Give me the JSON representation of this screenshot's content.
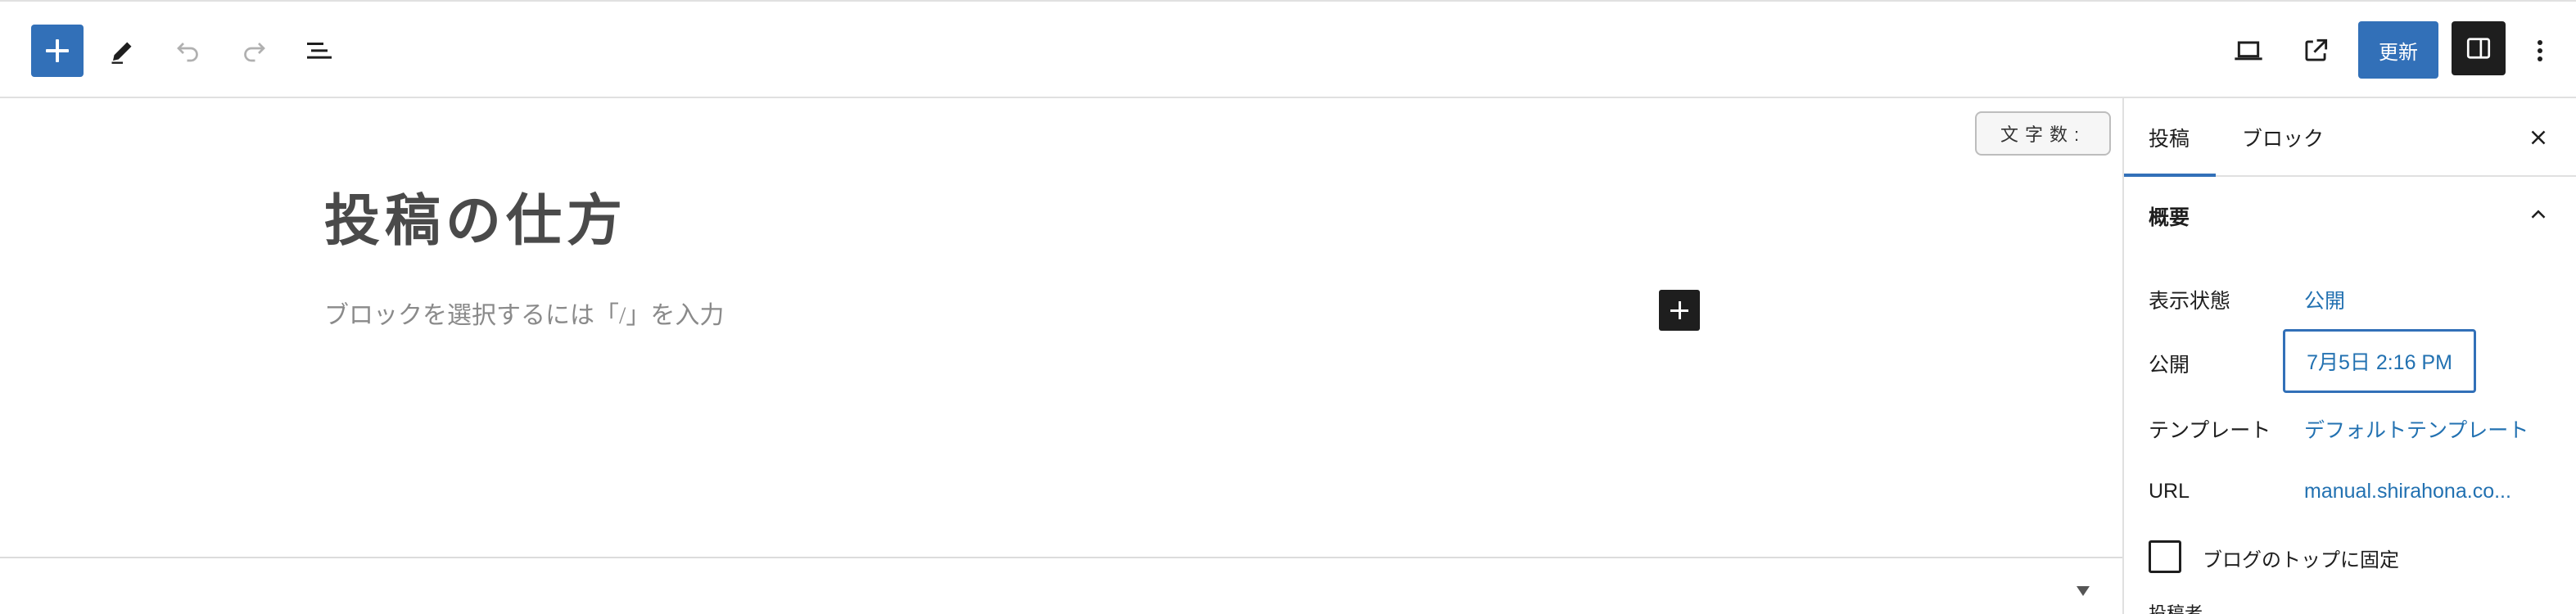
{
  "toolbar": {
    "inserter_icon": "plus-icon",
    "tools_icon": "pencil-icon",
    "undo_icon": "undo-icon",
    "redo_icon": "redo-icon",
    "document_overview_icon": "list-view-icon",
    "preview_icon": "laptop-icon",
    "view_post_icon": "external-link-icon",
    "update_label": "更新",
    "sidebar_toggle_icon": "sidebar-icon",
    "more_icon": "vertical-ellipsis-icon"
  },
  "editor": {
    "word_count_label": "文字数:",
    "title": "投稿の仕方",
    "block_placeholder": "ブロックを選択するには「/」を入力",
    "block_inserter_icon": "plus-icon"
  },
  "sidebar": {
    "tabs": [
      {
        "label": "投稿",
        "active": true
      },
      {
        "label": "ブロック",
        "active": false
      }
    ],
    "close_icon": "close-icon",
    "summary": {
      "title": "概要",
      "expanded": true,
      "rows": [
        {
          "label": "表示状態",
          "value": "公開"
        },
        {
          "label": "公開",
          "value": "7月5日 2:16 PM"
        },
        {
          "label": "テンプレート",
          "value": "デフォルトテンプレート"
        },
        {
          "label": "URL",
          "value": "manual.shirahona.co..."
        }
      ],
      "sticky_label": "ブログのトップに固定",
      "sticky_checked": false,
      "author_label": "投稿者"
    }
  },
  "colors": {
    "accent": "#3270b8",
    "link": "#2271b1",
    "dark": "#1e1e1e"
  }
}
